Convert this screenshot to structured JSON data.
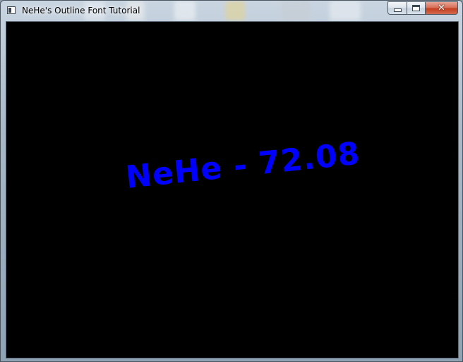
{
  "window": {
    "title": "NeHe's Outline Font Tutorial",
    "icon": "app-window-icon",
    "buttons": {
      "minimize": "minimize-icon",
      "maximize": "maximize-icon",
      "close_glyph": "✕"
    }
  },
  "scene": {
    "background_color": "#000000",
    "text_color": "#0000ff",
    "text": "NeHe - 72.08"
  }
}
